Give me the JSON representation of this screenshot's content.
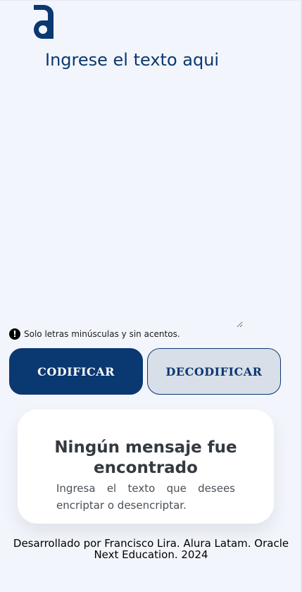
{
  "header": {
    "logo_icon": "alura-logo-icon"
  },
  "input": {
    "placeholder": "Ingrese el texto aqui",
    "value": ""
  },
  "hint": {
    "icon": "exclamation-circle-icon",
    "text": "Solo letras minúsculas y sin acentos."
  },
  "buttons": {
    "encrypt_label": "CODIFICAR",
    "decrypt_label": "DECODIFICAR"
  },
  "result": {
    "title": "Ningún mensaje fue encontrado",
    "text": "Ingresa el texto que desees encriptar o desencriptar."
  },
  "footer": {
    "text": "Desarrollado por Francisco Lira. Alura Latam. Oracle Next Education. 2024"
  },
  "colors": {
    "primary": "#0a3871",
    "background": "#f3f5fc",
    "secondary_button": "#d8dfe8",
    "card": "#ffffff"
  }
}
